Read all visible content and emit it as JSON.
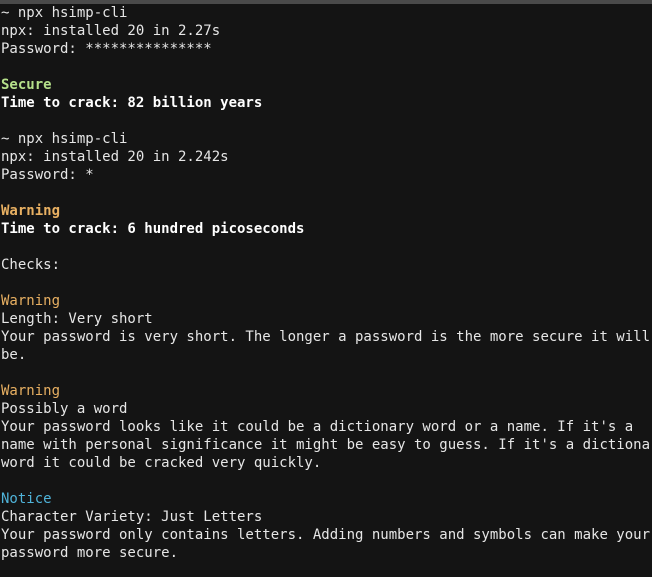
{
  "session1": {
    "prompt": "~ npx hsimp-cli",
    "installed": "npx: installed 20 in 2.27s",
    "password_label": "Password: ***************",
    "status": "Secure",
    "time_to_crack": "Time to crack: 82 billion years"
  },
  "session2": {
    "prompt": "~ npx hsimp-cli",
    "installed": "npx: installed 20 in 2.242s",
    "password_label": "Password: *",
    "status": "Warning",
    "time_to_crack": "Time to crack: 6 hundred picoseconds",
    "checks_header": "Checks:",
    "checks": [
      {
        "level": "Warning",
        "title": "Length: Very short",
        "lines": [
          "Your password is very short. The longer a password is the more secure it will",
          "be."
        ]
      },
      {
        "level": "Warning",
        "title": "Possibly a word",
        "lines": [
          "Your password looks like it could be a dictionary word or a name. If it's a",
          "name with personal significance it might be easy to guess. If it's a dictionary",
          "word it could be cracked very quickly."
        ]
      },
      {
        "level": "Notice",
        "title": "Character Variety: Just Letters",
        "lines": [
          "Your password only contains letters. Adding numbers and symbols can make your",
          "password more secure."
        ]
      }
    ]
  },
  "colors": {
    "background": "#141414",
    "text": "#e6e6e6",
    "secure": "#b5e08a",
    "warning": "#e8b062",
    "notice": "#4fb3d9"
  }
}
